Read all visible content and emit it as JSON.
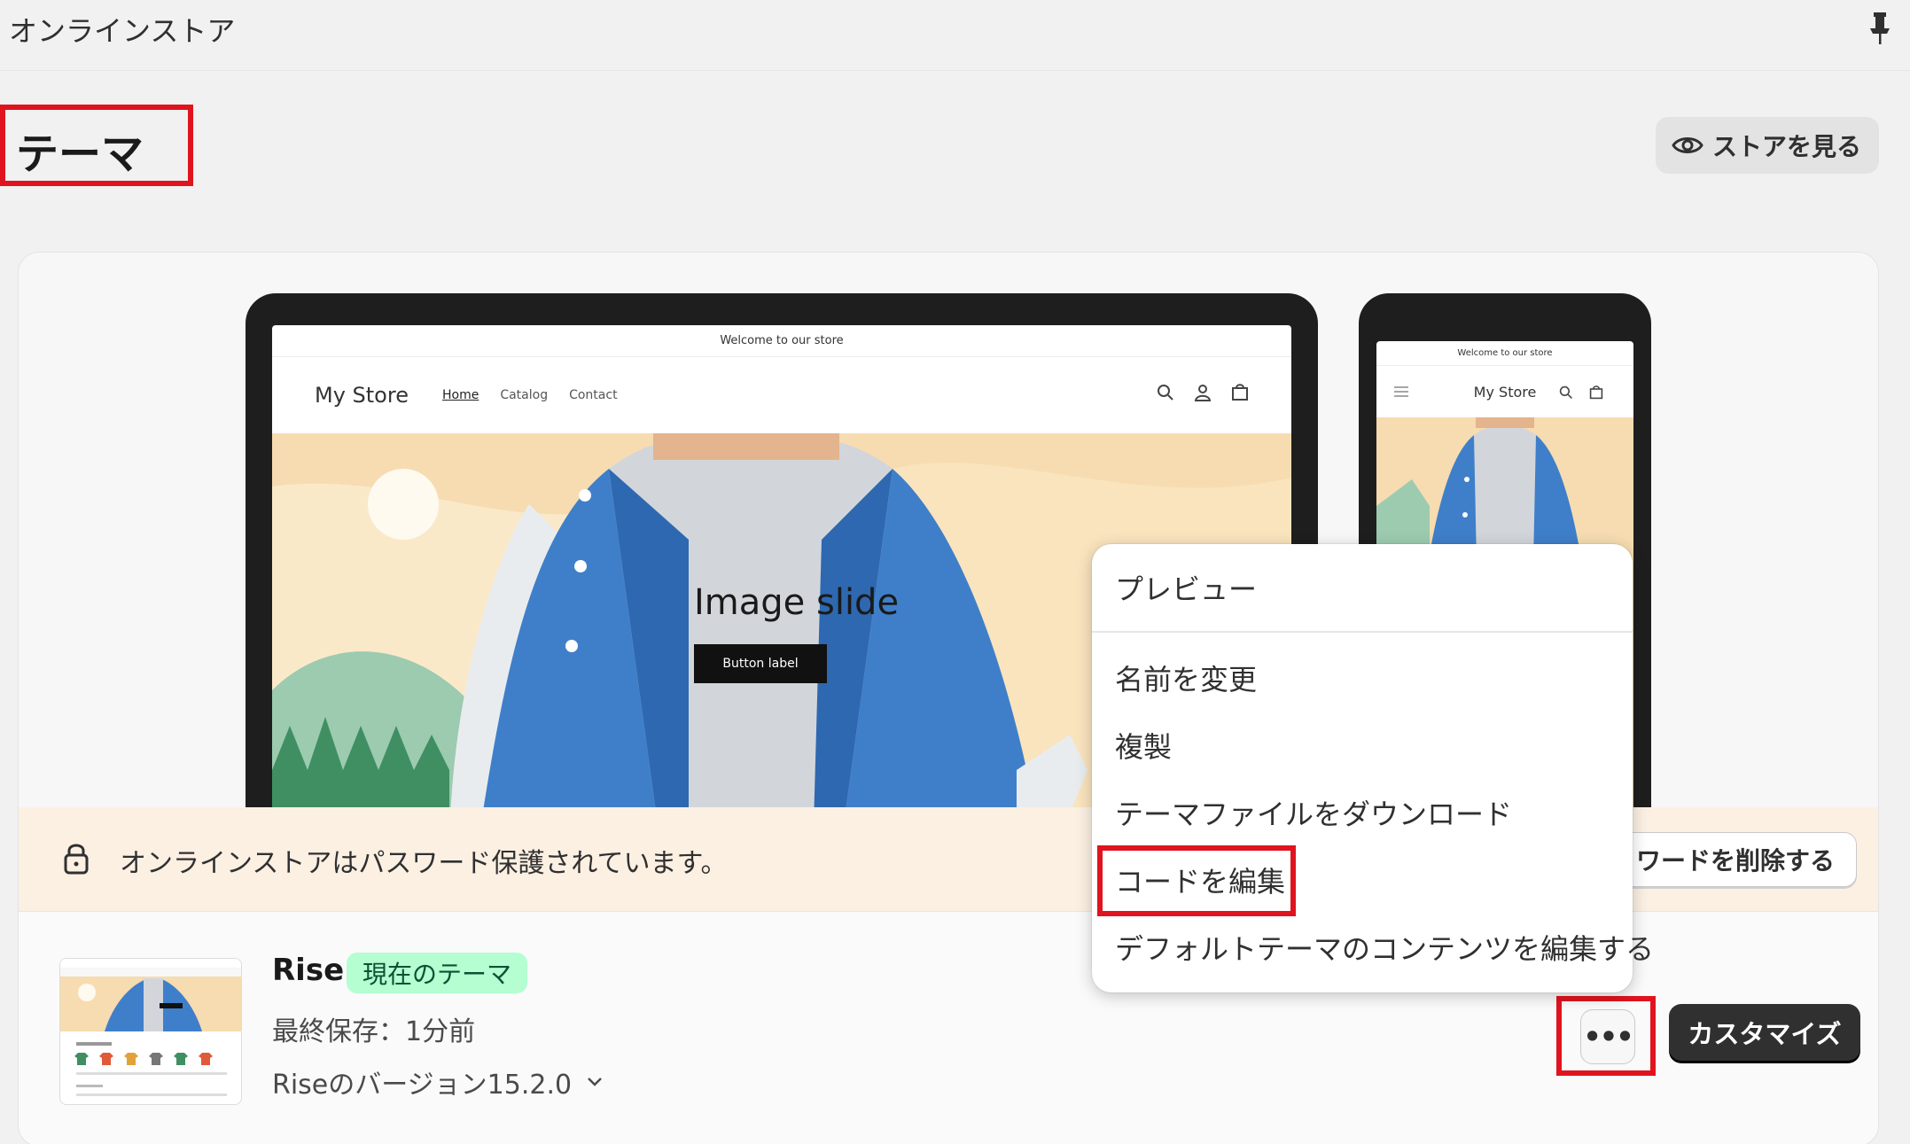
{
  "topbar": {
    "breadcrumb": "オンラインストア",
    "pin_icon": "pin-icon"
  },
  "header": {
    "title": "テーマ",
    "view_store_label": "ストアを見る",
    "view_store_icon": "eye-icon"
  },
  "preview": {
    "announcement": "Welcome to our store",
    "store_name": "My Store",
    "nav_links": [
      "Home",
      "Catalog",
      "Contact"
    ],
    "slide_title": "Image slide",
    "slide_button": "Button label"
  },
  "password_banner": {
    "text": "オンラインストアはパスワード保護されています。",
    "remove_button": "ワードを削除する"
  },
  "theme": {
    "name": "Rise",
    "badge": "現在のテーマ",
    "last_saved": "最終保存：1分前",
    "version": "Riseのバージョン15.2.0"
  },
  "actions": {
    "more_label": "•••",
    "customize_label": "カスタマイズ"
  },
  "menu": {
    "items": [
      "プレビュー",
      "名前を変更",
      "複製",
      "テーマファイルをダウンロード",
      "コードを編集",
      "デフォルトテーマのコンテンツを編集する"
    ]
  },
  "colors": {
    "highlight": "#e0141e",
    "badge_bg": "#b4fed2",
    "banner_bg": "#fcf0e3",
    "primary_button": "#303030"
  }
}
